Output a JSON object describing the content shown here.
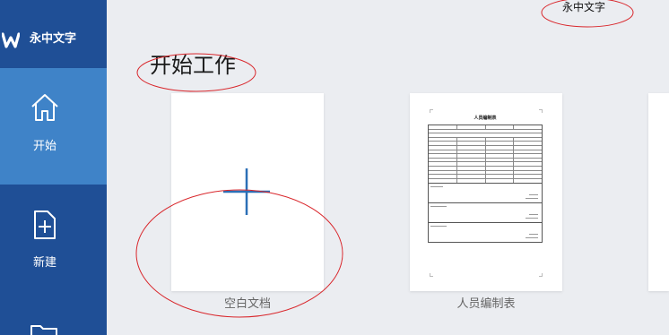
{
  "app": {
    "name": "永中文字",
    "brand_top": "永中文字"
  },
  "sidebar": {
    "items": [
      {
        "label": "开始",
        "icon": "home-icon",
        "active": true
      },
      {
        "label": "新建",
        "icon": "new-file-icon",
        "active": false
      },
      {
        "label": "",
        "icon": "folder-icon",
        "active": false
      }
    ]
  },
  "main": {
    "title": "开始工作",
    "cards": [
      {
        "label": "空白文档",
        "icon": "plus-icon"
      },
      {
        "label": "人员编制表",
        "doc_title": "人员编制表"
      }
    ]
  },
  "colors": {
    "sidebar": "#1f4f96",
    "sidebar_active": "#3f83c8",
    "background": "#ebedf1",
    "plus": "#2b6fb6",
    "annotation": "#d9262b"
  }
}
